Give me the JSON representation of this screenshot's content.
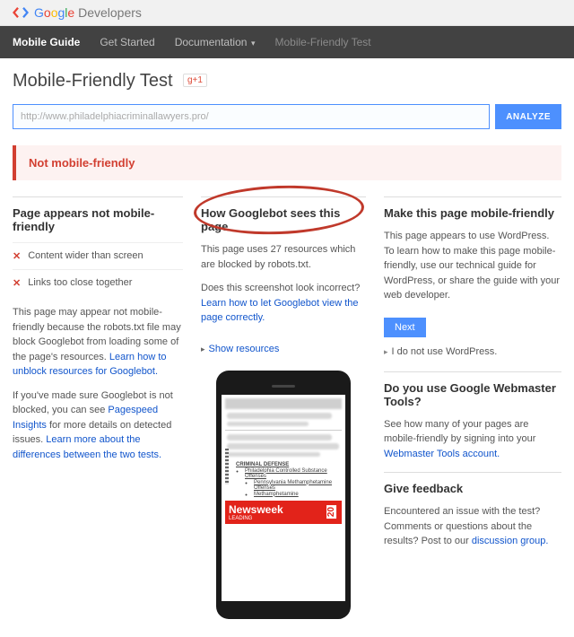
{
  "header": {
    "brand_google": "Google",
    "brand_dev": " Developers"
  },
  "nav": {
    "items": [
      {
        "label": "Mobile Guide"
      },
      {
        "label": "Get Started"
      },
      {
        "label": "Documentation"
      },
      {
        "label": "Mobile-Friendly Test"
      }
    ]
  },
  "page_title": "Mobile-Friendly Test",
  "gplus": "g+1",
  "analyze": {
    "url_value": "http://www.philadelphiacriminallawyers.pro/",
    "button": "ANALYZE"
  },
  "status": "Not mobile-friendly",
  "left": {
    "heading": "Page appears not mobile-friendly",
    "issues": [
      "Content wider than screen",
      "Links too close together"
    ],
    "note1_a": "This page may appear not mobile-friendly because the robots.txt file may block Googlebot from loading some of the page's resources. ",
    "note1_link": "Learn how to unblock resources for Googlebot.",
    "note2_a": "If you've made sure Googlebot is not blocked, you can see ",
    "note2_link1": "Pagespeed Insights",
    "note2_b": " for more details on detected issues. ",
    "note2_link2": "Learn more about the differences between the two tests."
  },
  "middle": {
    "heading": "How Googlebot sees this page",
    "blocked_msg": "This page uses 27 resources which are blocked by robots.txt.",
    "incorrect_a": "Does this screenshot look incorrect? ",
    "incorrect_link": "Learn how to let Googlebot view the page correctly.",
    "show_resources": "Show resources",
    "screen": {
      "list_title": "CRIMINAL DEFENSE",
      "items": [
        "Philadelphia Controlled Substance Offenses",
        "Pennsylvania Methamphetamine Offenses",
        "Methamphetamine"
      ],
      "newsweek": "Newsweek",
      "newsweek_sub": "LEADING",
      "badge": "20"
    }
  },
  "right": {
    "heading1": "Make this page mobile-friendly",
    "para1": "This page appears to use WordPress. To learn how to make this page mobile-friendly, use our technical guide for WordPress, or share the guide with your web developer.",
    "next": "Next",
    "nousewp": "I do not use WordPress.",
    "heading2": "Do you use Google Webmaster Tools?",
    "para2_a": "See how many of your pages are mobile-friendly by signing into your ",
    "para2_link": "Webmaster Tools account.",
    "heading3": "Give feedback",
    "para3_a": "Encountered an issue with the test? Comments or questions about the results? Post to our ",
    "para3_link": "discussion group."
  }
}
